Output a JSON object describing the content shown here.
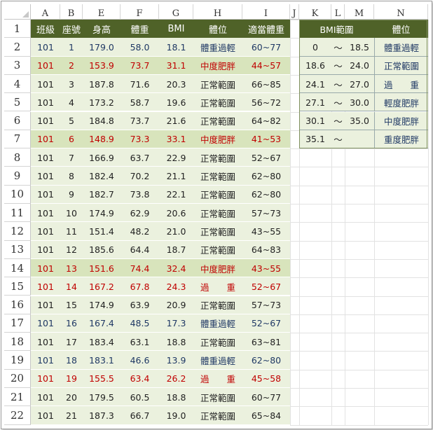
{
  "spreadsheet": {
    "column_headers": [
      "A",
      "B",
      "E",
      "F",
      "G",
      "H",
      "I",
      "J",
      "K",
      "L",
      "M",
      "N"
    ],
    "row_headers": [
      "1",
      "2",
      "3",
      "4",
      "5",
      "6",
      "7",
      "8",
      "9",
      "10",
      "11",
      "12",
      "13",
      "14",
      "15",
      "16",
      "17",
      "18",
      "19",
      "20",
      "21",
      "22"
    ],
    "header_row": {
      "class": "班級",
      "seat": "座號",
      "height": "身高",
      "weight": "體重",
      "bmi": "BMI",
      "status": "體位",
      "ideal_weight": "適當體重"
    },
    "rows": [
      {
        "class": "101",
        "seat": "1",
        "height": "179.0",
        "weight": "58.0",
        "bmi": "18.1",
        "status": "體重過輕",
        "ideal": "60~77",
        "tone": "navy",
        "band": "light"
      },
      {
        "class": "101",
        "seat": "2",
        "height": "153.9",
        "weight": "73.7",
        "bmi": "31.1",
        "status": "中度肥胖",
        "ideal": "44~57",
        "tone": "red",
        "band": "dark"
      },
      {
        "class": "101",
        "seat": "3",
        "height": "187.8",
        "weight": "71.6",
        "bmi": "20.3",
        "status": "正常範圍",
        "ideal": "66~85",
        "tone": "black",
        "band": "light"
      },
      {
        "class": "101",
        "seat": "4",
        "height": "173.2",
        "weight": "58.7",
        "bmi": "19.6",
        "status": "正常範圍",
        "ideal": "56~72",
        "tone": "black",
        "band": "light"
      },
      {
        "class": "101",
        "seat": "5",
        "height": "184.8",
        "weight": "73.7",
        "bmi": "21.6",
        "status": "正常範圍",
        "ideal": "64~82",
        "tone": "black",
        "band": "light"
      },
      {
        "class": "101",
        "seat": "6",
        "height": "148.9",
        "weight": "73.3",
        "bmi": "33.1",
        "status": "中度肥胖",
        "ideal": "41~53",
        "tone": "red",
        "band": "dark"
      },
      {
        "class": "101",
        "seat": "7",
        "height": "166.9",
        "weight": "63.7",
        "bmi": "22.9",
        "status": "正常範圍",
        "ideal": "52~67",
        "tone": "black",
        "band": "light"
      },
      {
        "class": "101",
        "seat": "8",
        "height": "182.4",
        "weight": "70.2",
        "bmi": "21.1",
        "status": "正常範圍",
        "ideal": "62~80",
        "tone": "black",
        "band": "light"
      },
      {
        "class": "101",
        "seat": "9",
        "height": "182.7",
        "weight": "73.8",
        "bmi": "22.1",
        "status": "正常範圍",
        "ideal": "62~80",
        "tone": "black",
        "band": "light"
      },
      {
        "class": "101",
        "seat": "10",
        "height": "174.9",
        "weight": "62.9",
        "bmi": "20.6",
        "status": "正常範圍",
        "ideal": "57~73",
        "tone": "black",
        "band": "light"
      },
      {
        "class": "101",
        "seat": "11",
        "height": "151.4",
        "weight": "48.2",
        "bmi": "21.0",
        "status": "正常範圍",
        "ideal": "43~55",
        "tone": "black",
        "band": "light"
      },
      {
        "class": "101",
        "seat": "12",
        "height": "185.6",
        "weight": "64.4",
        "bmi": "18.7",
        "status": "正常範圍",
        "ideal": "64~83",
        "tone": "black",
        "band": "light"
      },
      {
        "class": "101",
        "seat": "13",
        "height": "151.6",
        "weight": "74.4",
        "bmi": "32.4",
        "status": "中度肥胖",
        "ideal": "43~55",
        "tone": "red",
        "band": "dark"
      },
      {
        "class": "101",
        "seat": "14",
        "height": "167.2",
        "weight": "67.8",
        "bmi": "24.3",
        "status": "過　　重",
        "ideal": "52~67",
        "tone": "red",
        "band": "light"
      },
      {
        "class": "101",
        "seat": "15",
        "height": "174.9",
        "weight": "63.9",
        "bmi": "20.9",
        "status": "正常範圍",
        "ideal": "57~73",
        "tone": "black",
        "band": "light"
      },
      {
        "class": "101",
        "seat": "16",
        "height": "167.4",
        "weight": "48.5",
        "bmi": "17.3",
        "status": "體重過輕",
        "ideal": "52~67",
        "tone": "navy",
        "band": "light"
      },
      {
        "class": "101",
        "seat": "17",
        "height": "183.4",
        "weight": "63.1",
        "bmi": "18.8",
        "status": "正常範圍",
        "ideal": "63~81",
        "tone": "black",
        "band": "light"
      },
      {
        "class": "101",
        "seat": "18",
        "height": "183.1",
        "weight": "46.6",
        "bmi": "13.9",
        "status": "體重過輕",
        "ideal": "62~80",
        "tone": "navy",
        "band": "light"
      },
      {
        "class": "101",
        "seat": "19",
        "height": "155.5",
        "weight": "63.4",
        "bmi": "26.2",
        "status": "過　　重",
        "ideal": "45~58",
        "tone": "red",
        "band": "light"
      },
      {
        "class": "101",
        "seat": "20",
        "height": "179.5",
        "weight": "60.5",
        "bmi": "18.8",
        "status": "正常範圍",
        "ideal": "60~77",
        "tone": "black",
        "band": "light"
      },
      {
        "class": "101",
        "seat": "21",
        "height": "187.3",
        "weight": "66.7",
        "bmi": "19.0",
        "status": "正常範圍",
        "ideal": "65~84",
        "tone": "black",
        "band": "light"
      }
    ],
    "lookup": {
      "header_range": "BMI範圍",
      "header_status": "體位",
      "tilde": "～",
      "rows": [
        {
          "low": "0",
          "high": "18.5",
          "status": "體重過輕"
        },
        {
          "low": "18.6",
          "high": "24.0",
          "status": "正常範圍"
        },
        {
          "low": "24.1",
          "high": "27.0",
          "status": "過　　重"
        },
        {
          "low": "27.1",
          "high": "30.0",
          "status": "輕度肥胖"
        },
        {
          "low": "30.1",
          "high": "35.0",
          "status": "中度肥胖"
        },
        {
          "low": "35.1",
          "high": "",
          "status": "重度肥胖"
        }
      ]
    },
    "colors": {
      "header_bg": "#4f6228",
      "band_light": "#ebf1de",
      "band_dark": "#d8e4bc",
      "navy_text": "#1f3864",
      "red_text": "#c00000"
    }
  }
}
